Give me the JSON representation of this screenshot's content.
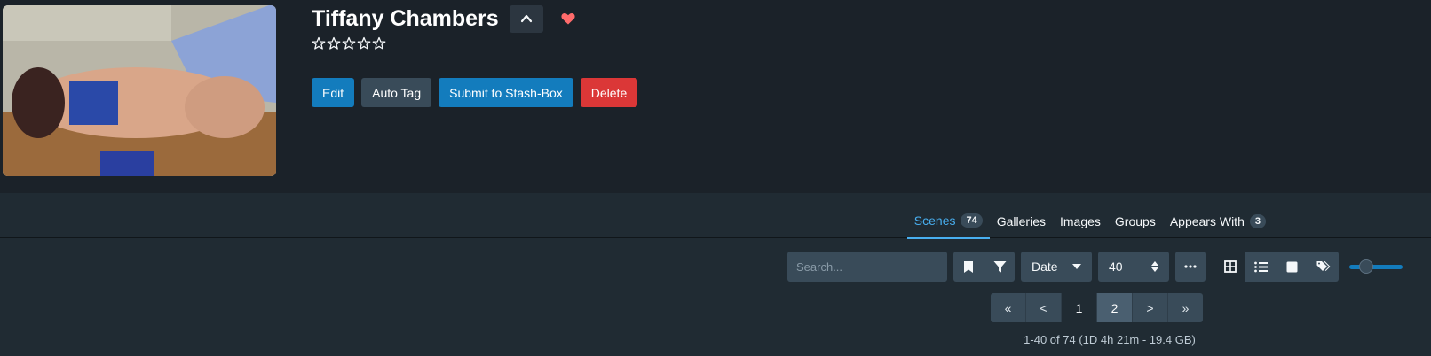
{
  "performer": {
    "name": "Tiffany Chambers",
    "rating_stars": 0,
    "rating_max": 5,
    "favorite": true
  },
  "actions": {
    "edit": "Edit",
    "auto_tag": "Auto Tag",
    "submit": "Submit to Stash-Box",
    "delete": "Delete"
  },
  "tabs": [
    {
      "label": "Scenes",
      "count": "74",
      "active": true
    },
    {
      "label": "Galleries"
    },
    {
      "label": "Images"
    },
    {
      "label": "Groups"
    },
    {
      "label": "Appears With",
      "count": "3"
    }
  ],
  "toolbar": {
    "search_placeholder": "Search...",
    "sort_by": "Date",
    "per_page": "40",
    "more_icon": "ellipsis-icon",
    "bookmark_icon": "bookmark-icon",
    "filter_icon": "filter-icon",
    "view_modes": [
      "grid-icon",
      "list-icon",
      "wall-icon",
      "tagger-icon"
    ],
    "active_view": "grid-icon",
    "zoom_level": 0.25
  },
  "pagination": {
    "first": "«",
    "prev": "<",
    "pages": [
      "1",
      "2"
    ],
    "current": "2",
    "next": ">",
    "last": "»"
  },
  "summary": "1-40 of 74 (1D 4h 21m - 19.4 GB)",
  "colors": {
    "primary": "#137cbd",
    "danger": "#db3737",
    "tab_active": "#48aff0",
    "favorite": "#ff6b6b"
  }
}
